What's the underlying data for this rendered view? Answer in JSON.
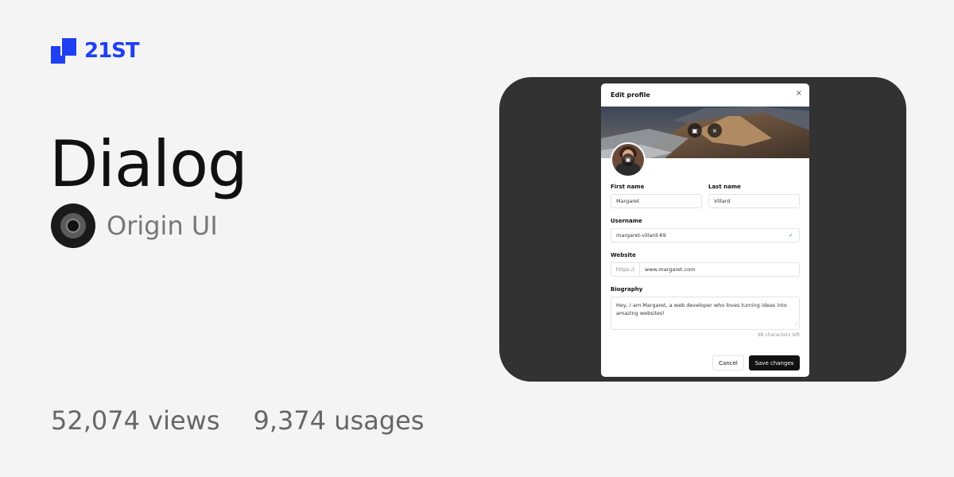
{
  "brand": {
    "name": "21ST",
    "color": "#1f3ff2"
  },
  "component": {
    "title": "Dialog",
    "author": "Origin UI"
  },
  "stats": {
    "views": "52,074 views",
    "usages": "9,374 usages"
  },
  "dialog": {
    "title": "Edit profile",
    "close_icon": "×",
    "banner_upload_icon": "image-plus-icon",
    "banner_remove_icon": "×",
    "fields": {
      "first_name": {
        "label": "First name",
        "value": "Margaret"
      },
      "last_name": {
        "label": "Last name",
        "value": "Villard"
      },
      "username": {
        "label": "Username",
        "value": "margaret-villard-69"
      },
      "website": {
        "label": "Website",
        "prefix": "https://",
        "value": "www.margaret.com"
      },
      "biography": {
        "label": "Biography",
        "value": "Hey, I am Margaret, a web developer who loves turning ideas into amazing websites!",
        "chars_left": "98 characters left"
      }
    },
    "buttons": {
      "cancel": "Cancel",
      "save": "Save changes"
    }
  }
}
